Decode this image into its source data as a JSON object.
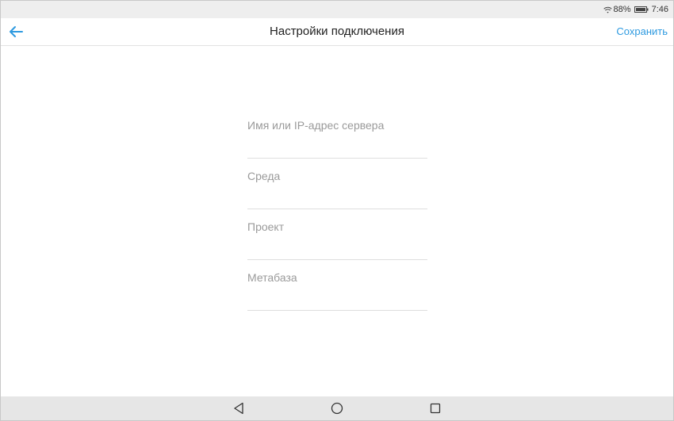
{
  "status_bar": {
    "battery_percent": "88%",
    "time": "7:46",
    "icons": [
      "wifi-icon",
      "battery-icon"
    ]
  },
  "app_bar": {
    "title": "Настройки подключения",
    "save_label": "Сохранить",
    "back_icon": "arrow-left-icon",
    "accent_color": "#2e9ae0"
  },
  "form": {
    "server": {
      "value": "",
      "placeholder": "Имя или IP-адрес сервера"
    },
    "environment": {
      "value": "",
      "placeholder": "Среда"
    },
    "project": {
      "value": "",
      "placeholder": "Проект"
    },
    "metabase": {
      "value": "",
      "placeholder": "Метабаза"
    }
  },
  "nav_bar": {
    "icons": [
      "nav-back-icon",
      "nav-home-icon",
      "nav-recent-icon"
    ]
  }
}
